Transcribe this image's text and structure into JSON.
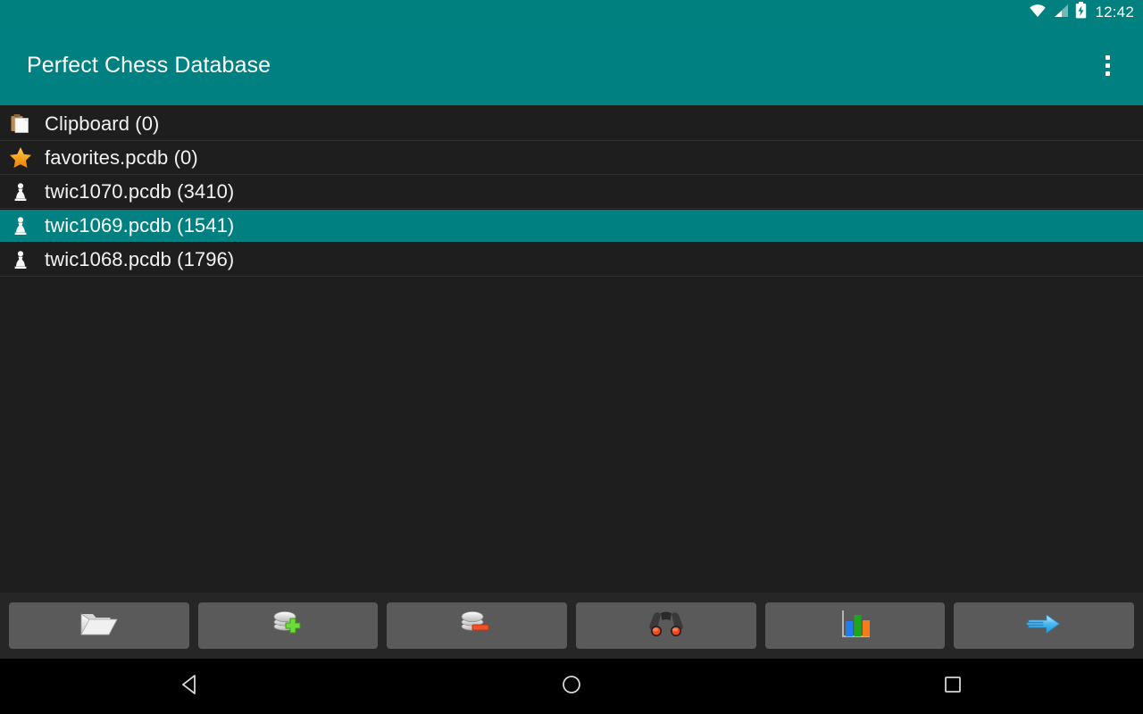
{
  "status_bar": {
    "time": "12:42",
    "icons": [
      "wifi-icon",
      "cell-signal-icon",
      "battery-charging-icon"
    ]
  },
  "app_bar": {
    "title": "Perfect Chess Database",
    "overflow_label": "More options",
    "background_color": "#008080"
  },
  "database_list": {
    "rows": [
      {
        "icon": "clipboard-icon",
        "label": "Clipboard (0)",
        "selected": false
      },
      {
        "icon": "star-icon",
        "label": "favorites.pcdb (0)",
        "selected": false
      },
      {
        "icon": "pawn-icon",
        "label": "twic1070.pcdb (3410)",
        "selected": false
      },
      {
        "icon": "pawn-icon",
        "label": "twic1069.pcdb (1541)",
        "selected": true
      },
      {
        "icon": "pawn-icon",
        "label": "twic1068.pcdb (1796)",
        "selected": false
      }
    ]
  },
  "toolbar": {
    "buttons": [
      {
        "name": "open-folder-button",
        "icon": "open-folder-icon"
      },
      {
        "name": "add-database-button",
        "icon": "database-add-icon"
      },
      {
        "name": "remove-database-button",
        "icon": "database-remove-icon"
      },
      {
        "name": "search-button",
        "icon": "binoculars-icon"
      },
      {
        "name": "statistics-button",
        "icon": "bar-chart-icon"
      },
      {
        "name": "next-button",
        "icon": "arrow-right-icon"
      }
    ]
  },
  "nav_bar": {
    "buttons": [
      {
        "name": "back-button",
        "icon": "triangle-back-icon"
      },
      {
        "name": "home-button",
        "icon": "circle-home-icon"
      },
      {
        "name": "recents-button",
        "icon": "square-recents-icon"
      }
    ]
  },
  "colors": {
    "accent_teal": "#008080",
    "list_background": "#1e1e1e",
    "toolbar_background": "#262626",
    "button_face": "#5a5a5a",
    "star_orange": "#f5a623",
    "text_primary": "#f2f2f2"
  }
}
